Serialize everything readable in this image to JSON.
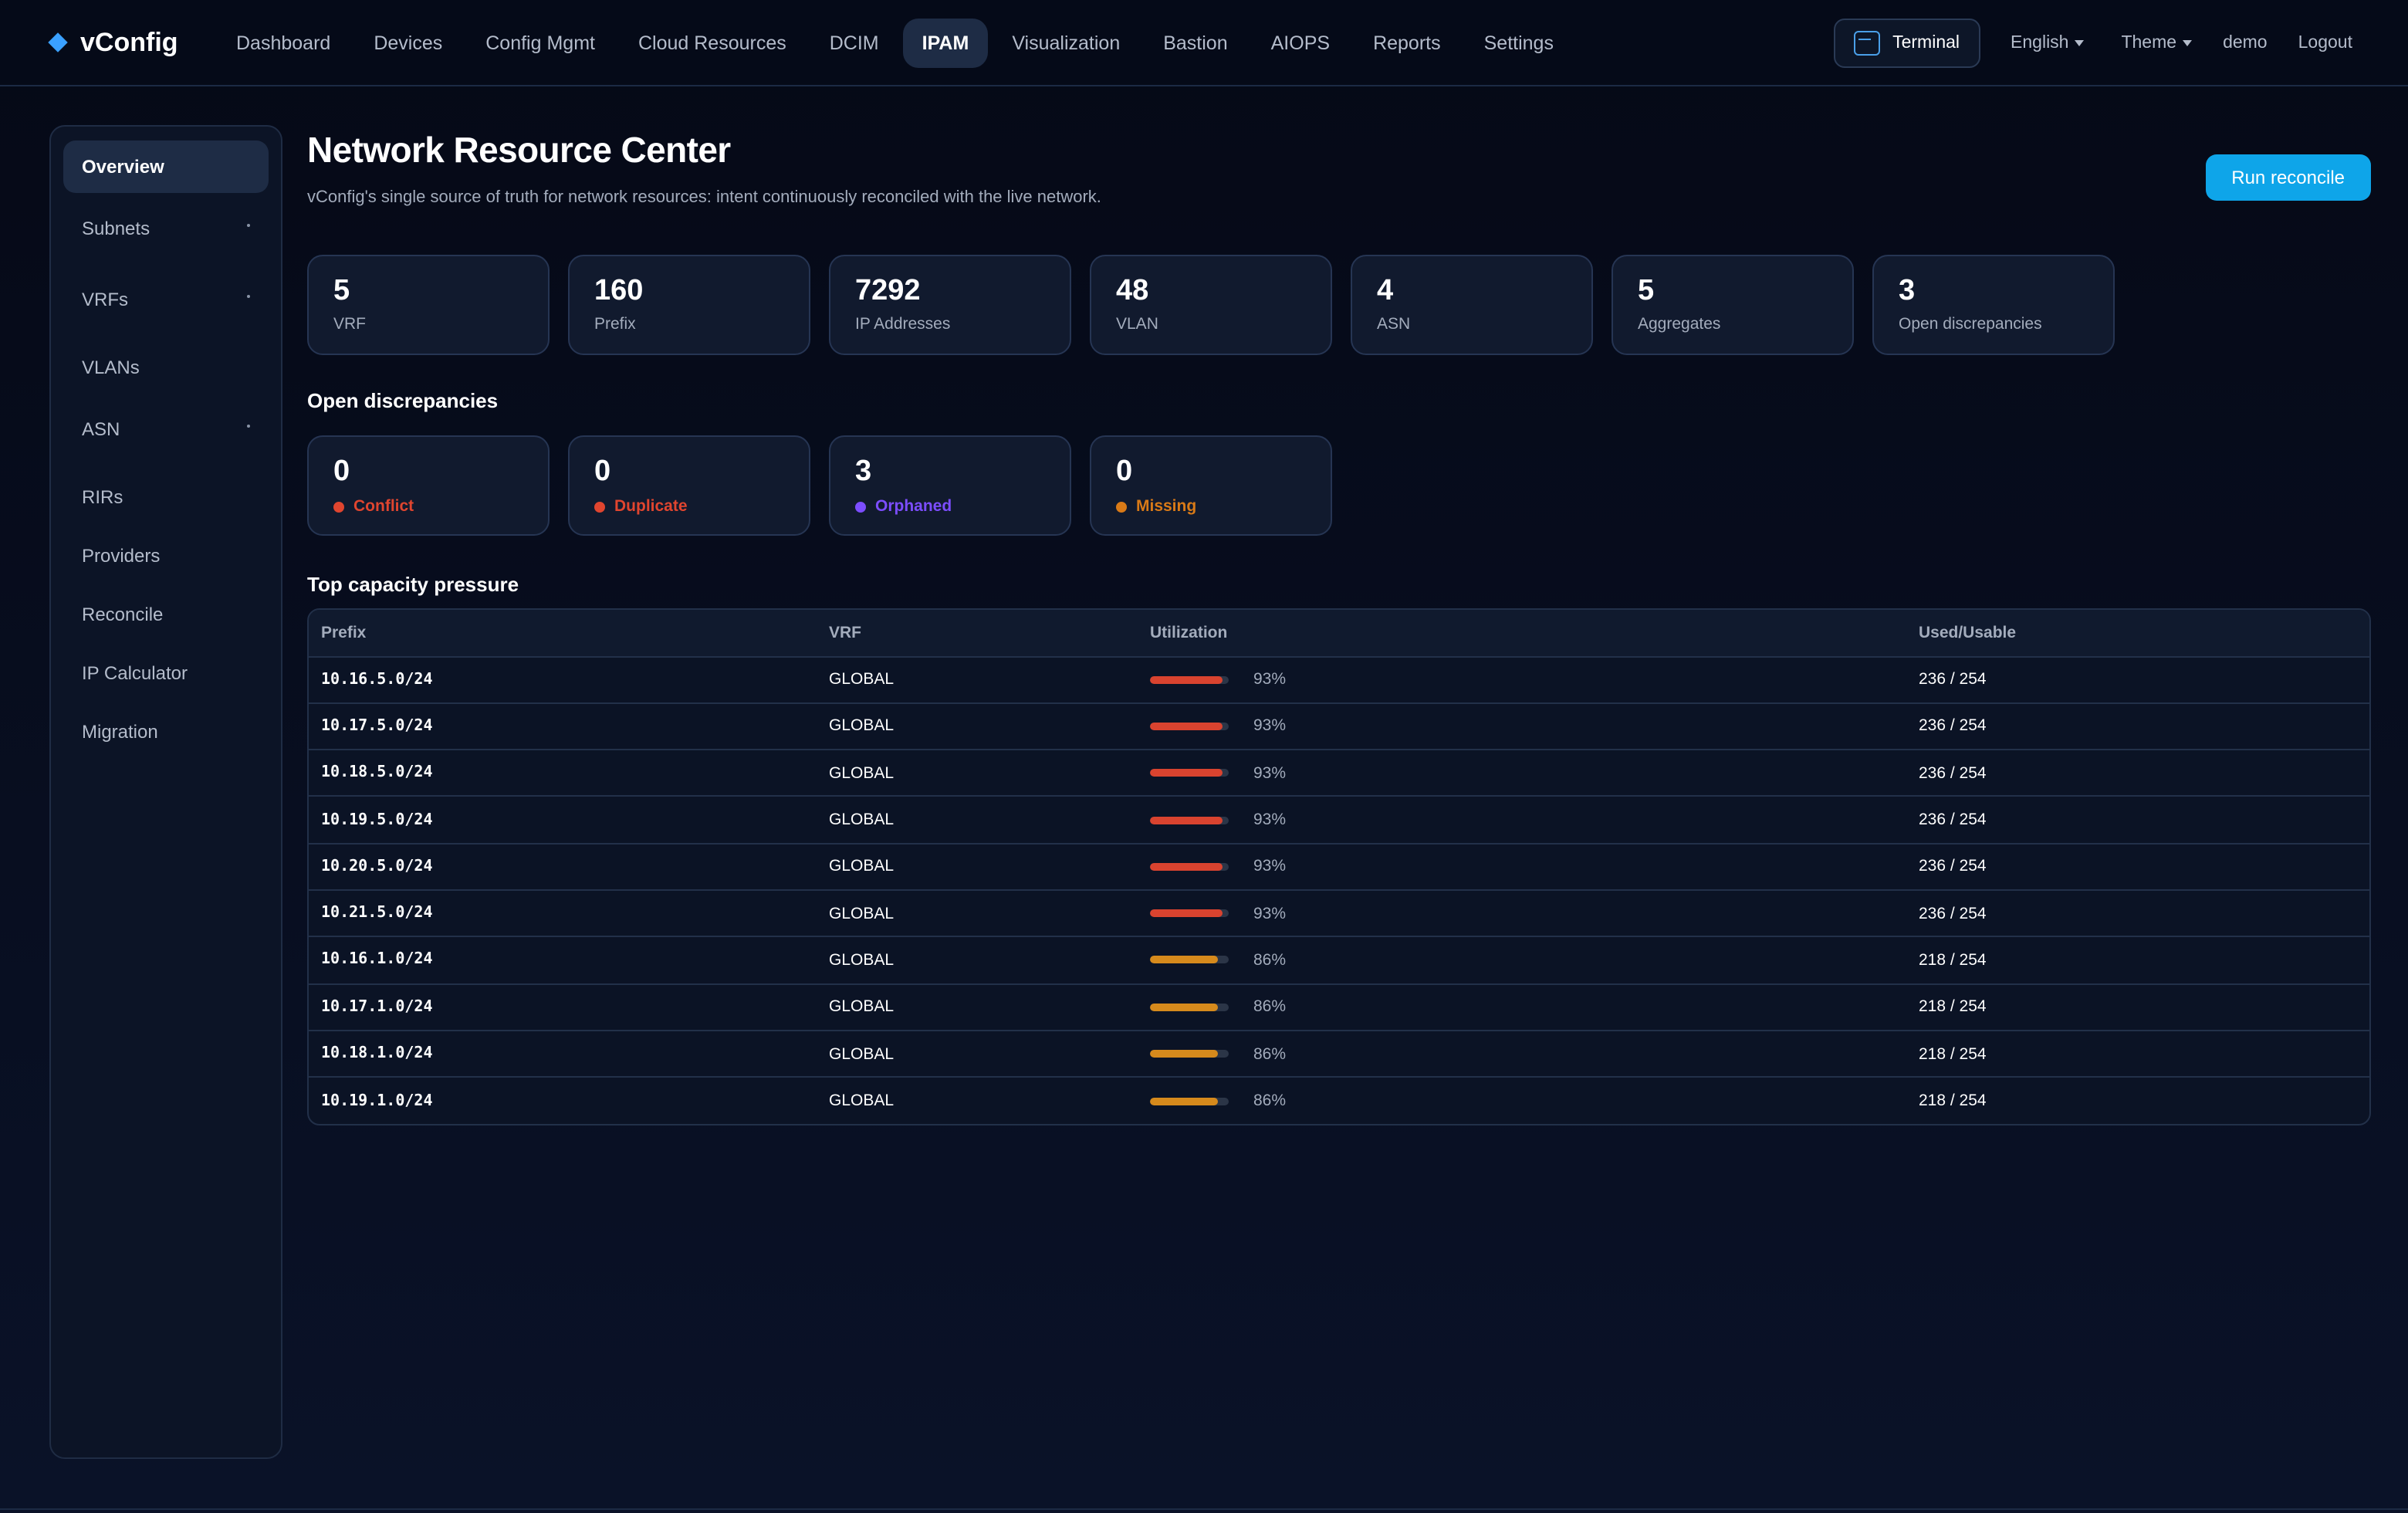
{
  "brand": {
    "name": "vConfig",
    "accent": "#3aa0ff"
  },
  "nav": {
    "items": [
      {
        "label": "Dashboard",
        "name": "nav-dashboard",
        "active": false
      },
      {
        "label": "Devices",
        "name": "nav-devices",
        "active": false
      },
      {
        "label": "Config Mgmt",
        "name": "nav-config-mgmt",
        "active": false
      },
      {
        "label": "Cloud Resources",
        "name": "nav-cloud-resources",
        "active": false
      },
      {
        "label": "DCIM",
        "name": "nav-dcim",
        "active": false
      },
      {
        "label": "IPAM",
        "name": "nav-ipam",
        "active": true
      },
      {
        "label": "Visualization",
        "name": "nav-visualization",
        "active": false
      },
      {
        "label": "Bastion",
        "name": "nav-bastion",
        "active": false
      },
      {
        "label": "AIOPS",
        "name": "nav-aiops",
        "active": false
      },
      {
        "label": "Reports",
        "name": "nav-reports",
        "active": false
      },
      {
        "label": "Settings",
        "name": "nav-settings",
        "active": false
      }
    ]
  },
  "tools": {
    "terminal": "Terminal",
    "language": "English",
    "theme": "Theme",
    "user": "demo",
    "logout": "Logout"
  },
  "sidebar": {
    "items": [
      {
        "label": "Overview",
        "name": "sidebar-item-overview",
        "active": true,
        "dot": false
      },
      {
        "label": "Subnets",
        "name": "sidebar-item-subnets",
        "active": false,
        "dot": true
      },
      {
        "label": "VRFs",
        "name": "sidebar-item-vrfs",
        "active": false,
        "dot": true
      },
      {
        "label": "VLANs",
        "name": "sidebar-item-vlans",
        "active": false,
        "dot": false
      },
      {
        "label": "ASN",
        "name": "sidebar-item-asn",
        "active": false,
        "dot": true
      },
      {
        "label": "RIRs",
        "name": "sidebar-item-rirs",
        "active": false,
        "dot": false
      },
      {
        "label": "Providers",
        "name": "sidebar-item-providers",
        "active": false,
        "dot": false
      },
      {
        "label": "Reconcile",
        "name": "sidebar-item-reconcile",
        "active": false,
        "dot": false
      },
      {
        "label": "IP Calculator",
        "name": "sidebar-item-ip-calculator",
        "active": false,
        "dot": false
      },
      {
        "label": "Migration",
        "name": "sidebar-item-migration",
        "active": false,
        "dot": false
      }
    ]
  },
  "page": {
    "title": "Network Resource Center",
    "subtitle": "vConfig's single source of truth for network resources: intent continuously reconciled with the live network.",
    "run_button": "Run reconcile"
  },
  "stats": [
    {
      "value": "5",
      "label": "VRF"
    },
    {
      "value": "160",
      "label": "Prefix"
    },
    {
      "value": "7292",
      "label": "IP Addresses"
    },
    {
      "value": "48",
      "label": "VLAN"
    },
    {
      "value": "4",
      "label": "ASN"
    },
    {
      "value": "5",
      "label": "Aggregates"
    },
    {
      "value": "3",
      "label": "Open discrepancies"
    }
  ],
  "discrepancies": {
    "title": "Open discrepancies",
    "items": [
      {
        "value": "0",
        "label": "Conflict",
        "color": "#e0452f"
      },
      {
        "value": "0",
        "label": "Duplicate",
        "color": "#e0452f"
      },
      {
        "value": "3",
        "label": "Orphaned",
        "color": "#7c4dff"
      },
      {
        "value": "0",
        "label": "Missing",
        "color": "#d97a17"
      }
    ]
  },
  "capacity": {
    "title": "Top capacity pressure",
    "columns": [
      "Prefix",
      "VRF",
      "Utilization",
      "Used/Usable"
    ],
    "rows": [
      {
        "prefix": "10.16.5.0/24",
        "vrf": "GLOBAL",
        "util": 93,
        "util_label": "93%",
        "used": "236 / 254",
        "color": "#d9432f"
      },
      {
        "prefix": "10.17.5.0/24",
        "vrf": "GLOBAL",
        "util": 93,
        "util_label": "93%",
        "used": "236 / 254",
        "color": "#d9432f"
      },
      {
        "prefix": "10.18.5.0/24",
        "vrf": "GLOBAL",
        "util": 93,
        "util_label": "93%",
        "used": "236 / 254",
        "color": "#d9432f"
      },
      {
        "prefix": "10.19.5.0/24",
        "vrf": "GLOBAL",
        "util": 93,
        "util_label": "93%",
        "used": "236 / 254",
        "color": "#d9432f"
      },
      {
        "prefix": "10.20.5.0/24",
        "vrf": "GLOBAL",
        "util": 93,
        "util_label": "93%",
        "used": "236 / 254",
        "color": "#d9432f"
      },
      {
        "prefix": "10.21.5.0/24",
        "vrf": "GLOBAL",
        "util": 93,
        "util_label": "93%",
        "used": "236 / 254",
        "color": "#d9432f"
      },
      {
        "prefix": "10.16.1.0/24",
        "vrf": "GLOBAL",
        "util": 86,
        "util_label": "86%",
        "used": "218 / 254",
        "color": "#d68a1c"
      },
      {
        "prefix": "10.17.1.0/24",
        "vrf": "GLOBAL",
        "util": 86,
        "util_label": "86%",
        "used": "218 / 254",
        "color": "#d68a1c"
      },
      {
        "prefix": "10.18.1.0/24",
        "vrf": "GLOBAL",
        "util": 86,
        "util_label": "86%",
        "used": "218 / 254",
        "color": "#d68a1c"
      },
      {
        "prefix": "10.19.1.0/24",
        "vrf": "GLOBAL",
        "util": 86,
        "util_label": "86%",
        "used": "218 / 254",
        "color": "#d68a1c"
      }
    ]
  }
}
